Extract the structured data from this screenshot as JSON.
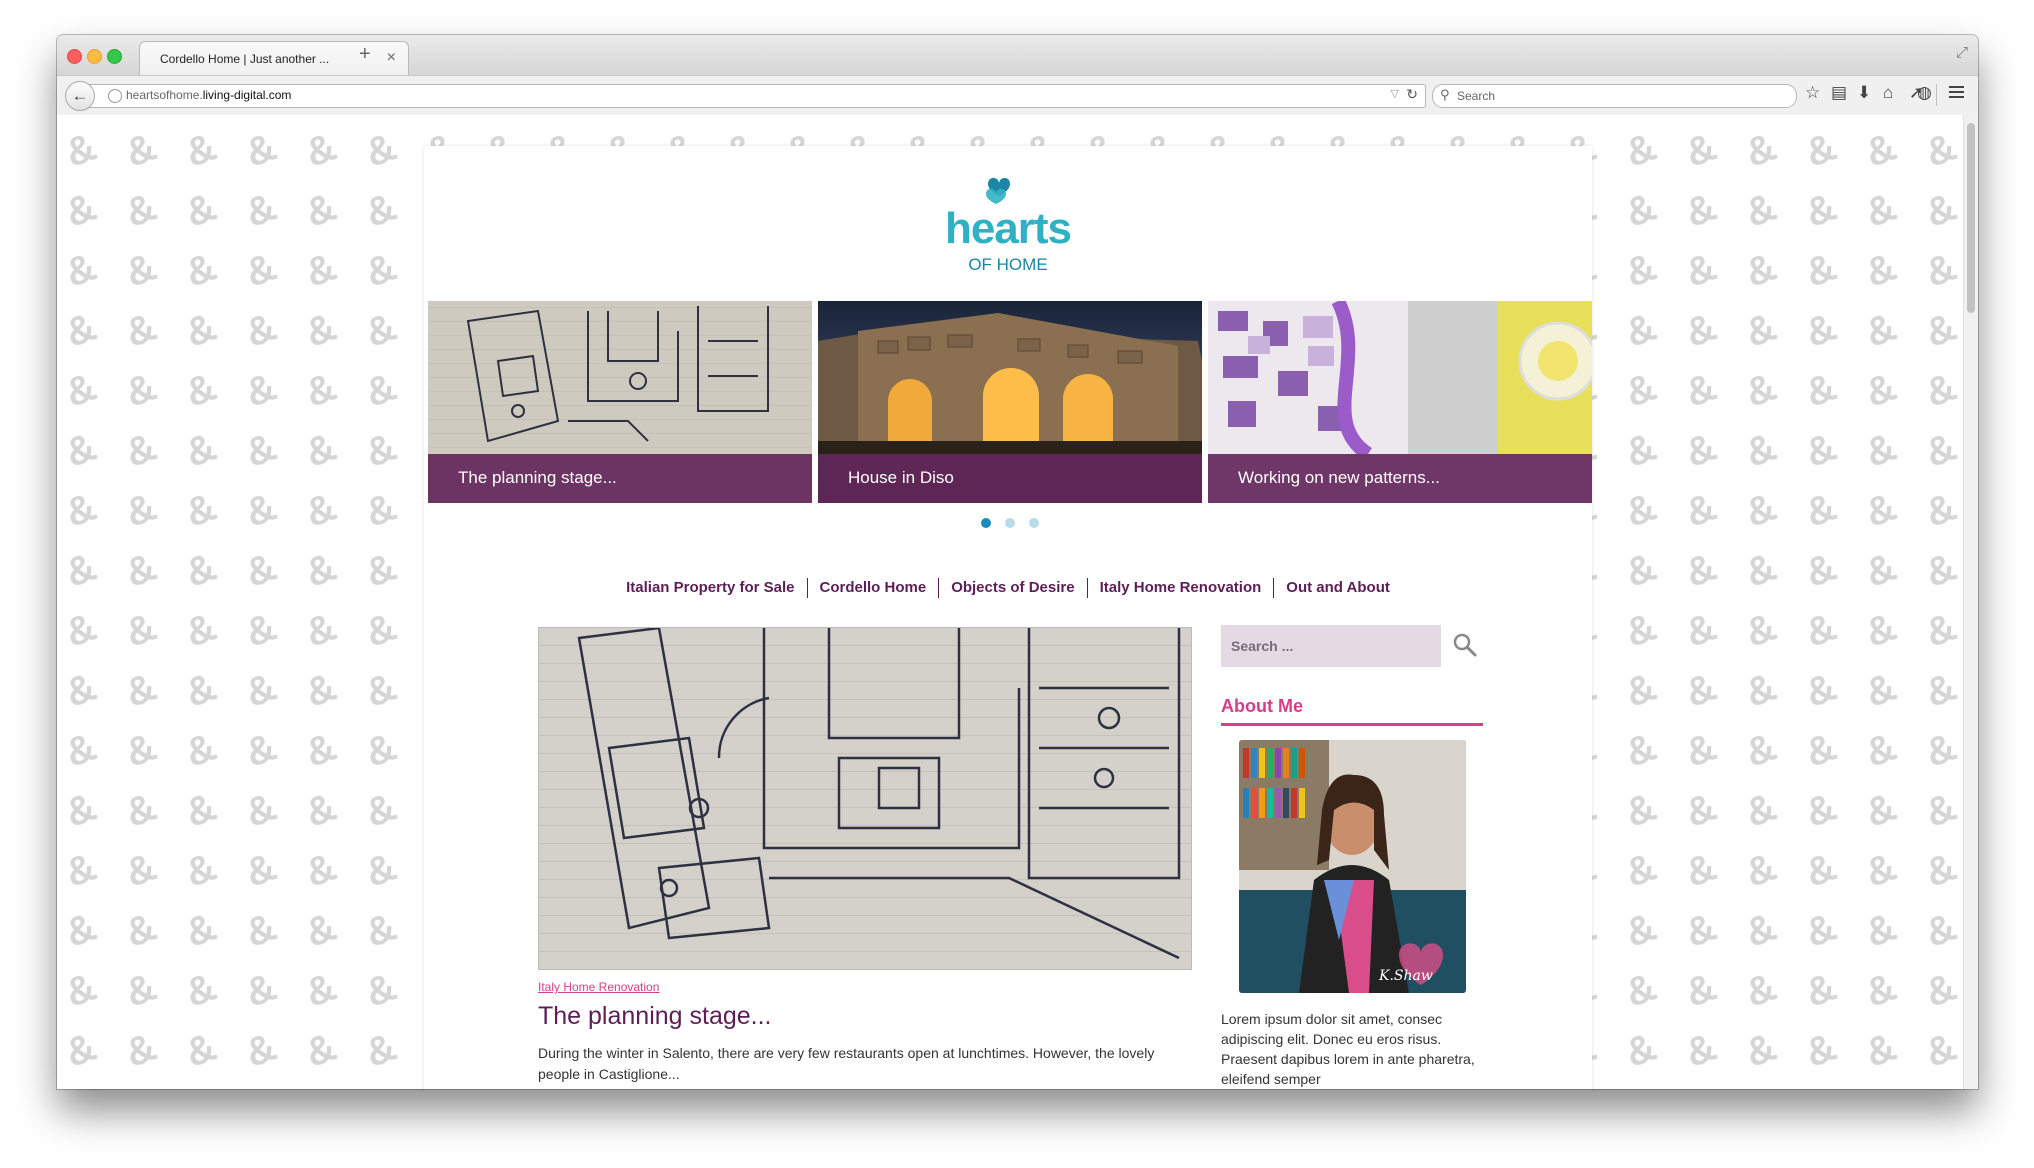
{
  "browser": {
    "tab_title": "Cordello Home | Just another ...",
    "url_prefix": "heartsofhome.",
    "url_domain": "living-digital.com",
    "search_placeholder": "Search",
    "tab_close": "×",
    "new_tab": "+",
    "back": "←",
    "reload": "C"
  },
  "logo": {
    "title": "hearts",
    "subtitle": "OF HOME"
  },
  "slider": {
    "slides": [
      {
        "caption": "The planning stage..."
      },
      {
        "caption": "House in Diso"
      },
      {
        "caption": "Working on new patterns..."
      }
    ],
    "active_index": 0
  },
  "nav": {
    "items": [
      "Italian Property for Sale",
      "Cordello Home",
      "Objects of Desire",
      "Italy Home Renovation",
      "Out and About"
    ]
  },
  "post": {
    "category": "Italy Home Renovation",
    "title": "The planning stage...",
    "excerpt": "During the winter in Salento, there are very few restaurants open at lunchtimes. However, the lovely people in Castiglione..."
  },
  "sidebar": {
    "search_placeholder": "Search ...",
    "about_title": "About Me",
    "about_text": "Lorem ipsum dolor sit amet, consec adipiscing elit. Donec eu eros risus. Praesent dapibus lorem in ante pharetra, eleifend semper",
    "signature": "K.Shaw"
  },
  "colors": {
    "brand_purple": "#5b1f56",
    "brand_teal": "#2fb1c3",
    "accent_pink": "#d43e8c",
    "caption_bg": "#63275b"
  }
}
